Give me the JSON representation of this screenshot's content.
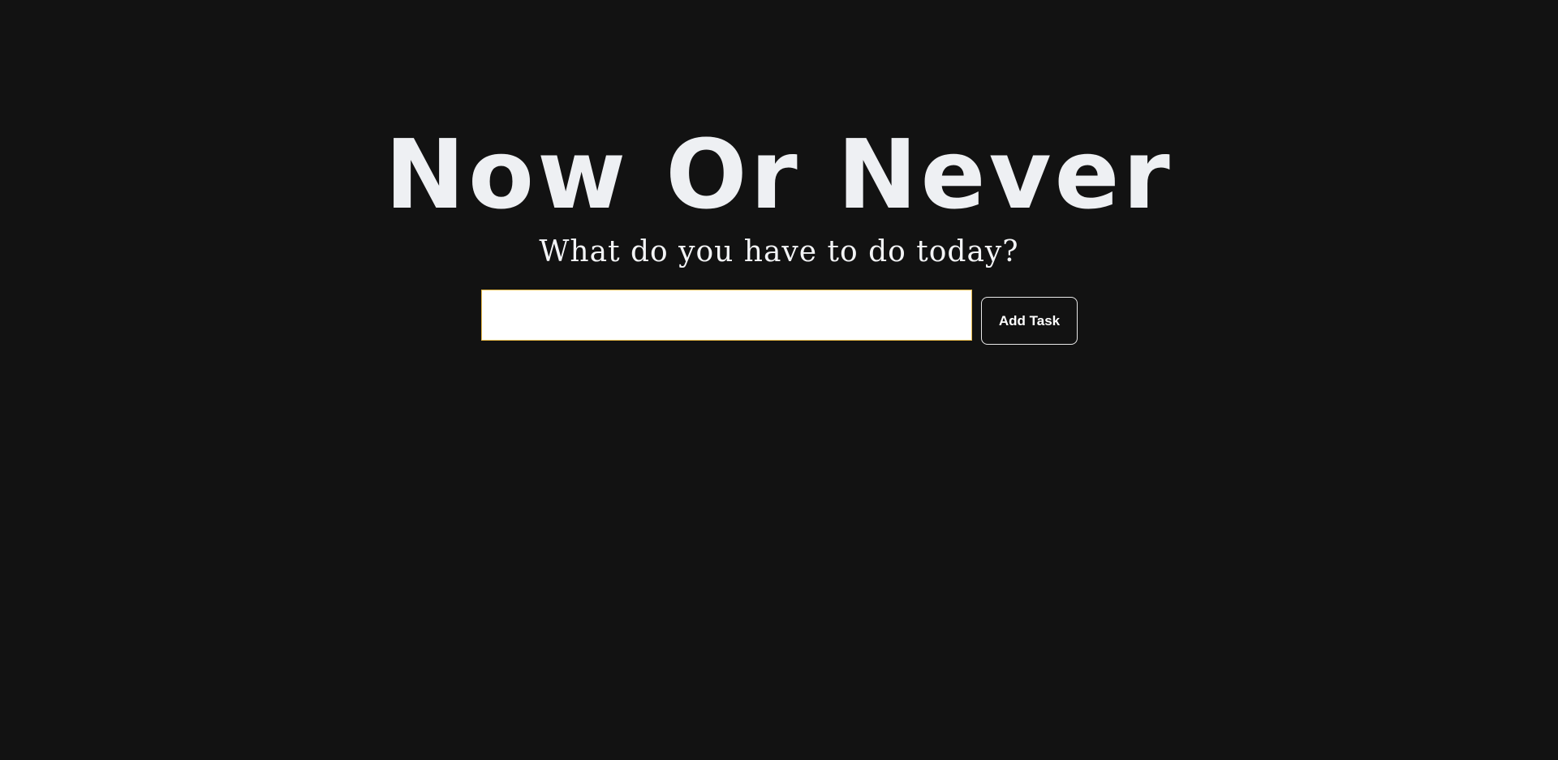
{
  "header": {
    "title": "Now Or Never",
    "subtitle": "What do you have to do today?"
  },
  "task_form": {
    "input_value": "",
    "input_placeholder": "",
    "add_button_label": "Add Task"
  },
  "colors": {
    "background": "#121212",
    "text": "#eef0f3",
    "input_border": "#e8b94a",
    "button_border": "#e9e9e9"
  }
}
